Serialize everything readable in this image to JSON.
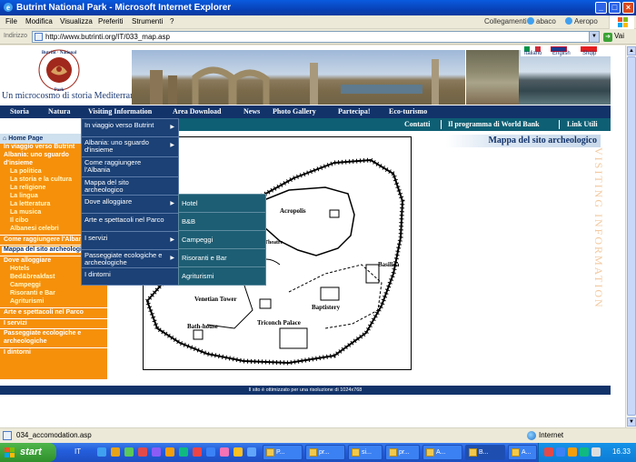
{
  "window": {
    "title": "Butrint National Park - Microsoft Internet Explorer"
  },
  "menubar": {
    "items": [
      "File",
      "Modifica",
      "Visualizza",
      "Preferiti",
      "Strumenti",
      "?"
    ],
    "links_label": "Collegamenti",
    "links": [
      "abaco",
      "Aeropo"
    ]
  },
  "addressbar": {
    "label": "Indirizzo",
    "url": "http://www.butrinti.org/IT/033_map.asp",
    "go_label": "Vai"
  },
  "site": {
    "logo_text": "Butrint National Park",
    "tagline": "Un microcosmo di storia Mediterranea",
    "languages": [
      "Italiano",
      "English",
      "Shqip"
    ],
    "nav_primary": [
      "Storia",
      "Natura",
      "Visiting Information",
      "Area Download",
      "News",
      "Photo Gallery",
      "Partecipa!",
      "Eco-turismo"
    ],
    "nav_secondary": [
      "Contatti",
      "Il programma di World Bank",
      "Link Utili"
    ],
    "left_menu": {
      "home": "Home Page",
      "items": [
        {
          "label": "In viaggio verso Butrint",
          "sub": false
        },
        {
          "label": "Albania: uno sguardo",
          "sub": false
        },
        {
          "label": "d'insieme",
          "sub": false
        },
        {
          "label": "La politica",
          "sub": true
        },
        {
          "label": "La storia e la cultura",
          "sub": true
        },
        {
          "label": "La religione",
          "sub": true
        },
        {
          "label": "La lingua",
          "sub": true
        },
        {
          "label": "La letteratura",
          "sub": true
        },
        {
          "label": "La musica",
          "sub": true
        },
        {
          "label": "Il cibo",
          "sub": true
        },
        {
          "label": "Albanesi celebri",
          "sub": true
        },
        {
          "label": "Come raggiungere l'Albania",
          "sub": false
        },
        {
          "label": "Mappa del sito archeologico",
          "sub": false,
          "active": true
        },
        {
          "label": "Dove alloggiare",
          "sub": false
        },
        {
          "label": "Hotels",
          "sub": true
        },
        {
          "label": "Bed&breakfast",
          "sub": true
        },
        {
          "label": "Campeggi",
          "sub": true
        },
        {
          "label": "Risoranti e Bar",
          "sub": true
        },
        {
          "label": "Agriturismi",
          "sub": true
        },
        {
          "label": "Arte e spettacoli nel Parco",
          "sub": false
        },
        {
          "label": "I servizi",
          "sub": false
        },
        {
          "label": "Passeggiate ecologiche e",
          "sub": false
        },
        {
          "label": "archeologiche",
          "sub": false
        },
        {
          "label": "I dintorni",
          "sub": false
        }
      ]
    },
    "dropdown_main": [
      {
        "label": "In viaggio verso Butrint",
        "arrow": true
      },
      {
        "label": "Albania: uno sguardo d'insieme",
        "arrow": true
      },
      {
        "label": "Come raggiungere l'Albania",
        "arrow": false
      },
      {
        "label": "Mappa del sito archeologico",
        "arrow": false
      },
      {
        "label": "Dove alloggiare",
        "arrow": true
      },
      {
        "label": "Arte e spettacoli nel Parco",
        "arrow": false
      },
      {
        "label": "I servizi",
        "arrow": true
      },
      {
        "label": "Passeggiate ecologiche e archeologiche",
        "arrow": true
      },
      {
        "label": "I dintorni",
        "arrow": false
      }
    ],
    "dropdown_sub": [
      "Hotel",
      "B&B",
      "Campeggi",
      "Risoranti e Bar",
      "Agriturismi"
    ],
    "page_title": "Mappa del sito archeologico",
    "side_watermark": "VISITING INFORMATION",
    "map_labels": [
      "Acropolis",
      "Basilica",
      "Baptistery",
      "Venetian Tower",
      "Triconch Palace",
      "Bath-house",
      "Theatre"
    ],
    "footer_note": "Il sito è ottimizzato per una risoluzione di 1024x768"
  },
  "statusbar": {
    "text": "034_accomodation.asp",
    "zone": "Internet"
  },
  "taskbar": {
    "start_label": "start",
    "lang": "IT",
    "tasks": [
      {
        "label": "P...",
        "active": false
      },
      {
        "label": "pr...",
        "active": false
      },
      {
        "label": "si...",
        "active": false
      },
      {
        "label": "pr...",
        "active": false
      },
      {
        "label": "A...",
        "active": false
      },
      {
        "label": "B...",
        "active": true
      },
      {
        "label": "A...",
        "active": false
      }
    ],
    "clock": "16.33"
  }
}
